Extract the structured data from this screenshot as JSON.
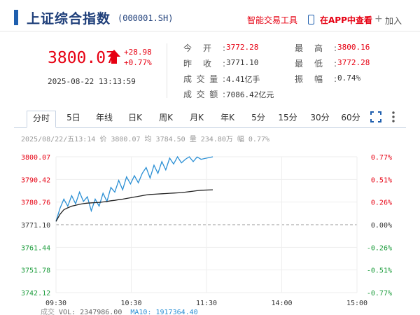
{
  "header": {
    "title": "上证综合指数",
    "code": "(000001.SH)",
    "smart_tools": "智能交易工具",
    "app_view": "在APP中查看",
    "add_label": "加入"
  },
  "quote": {
    "price": "3800.07",
    "change": "+28.98",
    "change_pct": "+0.77%",
    "datetime": "2025-08-22 13:13:59",
    "fields": [
      {
        "label": "今开:",
        "value": "3772.28",
        "color": "red"
      },
      {
        "label": "昨收:",
        "value": "3771.10",
        "color": "normal"
      },
      {
        "label": "成交量:",
        "value": "4.41亿手",
        "color": "normal"
      },
      {
        "label": "成交额:",
        "value": "7086.42亿元",
        "color": "normal"
      },
      {
        "label": "最高:",
        "value": "3800.16",
        "color": "red"
      },
      {
        "label": "最低:",
        "value": "3772.28",
        "color": "red"
      },
      {
        "label": "振幅:",
        "value": "0.74%",
        "color": "normal"
      }
    ]
  },
  "tabs": [
    "分时",
    "5日",
    "年线",
    "日K",
    "周K",
    "月K",
    "年K",
    "5分",
    "15分",
    "30分",
    "60分"
  ],
  "active_tab": "分时",
  "infoline": "2025/08/22/五13:14 价 3800.07 均 3784.50 量 234.80万 幅 0.77%",
  "bottom": {
    "prefix": "成交",
    "vol": "VOL: 2347986.00",
    "ma10": "MA10: 1917364.40"
  },
  "colors": {
    "up": "#e60012",
    "down": "#1a9b3a",
    "price_line": "#2a8fd4",
    "avg_line": "#222222",
    "brand": "#1f5fae"
  },
  "chart_data": {
    "type": "line",
    "y_left_ticks": [
      "3800.07",
      "3790.42",
      "3780.76",
      "3771.10",
      "3761.44",
      "3751.78",
      "3742.12"
    ],
    "y_right_ticks": [
      "0.77%",
      "0.51%",
      "0.26%",
      "0.00%",
      "-0.26%",
      "-0.51%",
      "-0.77%"
    ],
    "x_ticks": [
      "09:30",
      "10:30",
      "11:30",
      "14:00",
      "15:00"
    ],
    "ylim": [
      3742.12,
      3800.07
    ],
    "x_time_minutes": [
      0,
      5,
      10,
      15,
      20,
      25,
      30,
      35,
      40,
      45,
      50,
      55,
      60,
      65,
      70,
      75,
      80,
      85,
      90,
      95,
      100,
      105,
      110,
      115,
      120,
      125,
      130,
      135,
      140,
      145,
      150,
      155,
      160,
      165,
      170,
      175,
      180,
      185,
      200
    ],
    "series": [
      {
        "values": [
          3772.5,
          3778.0,
          3782.0,
          3779.0,
          3783.5,
          3780.0,
          3785.0,
          3781.0,
          3783.0,
          3777.0,
          3782.0,
          3779.0,
          3784.5,
          3781.0,
          3787.0,
          3785.0,
          3790.0,
          3786.0,
          3791.5,
          3788.5,
          3792.0,
          3789.0,
          3793.0,
          3795.5,
          3791.0,
          3796.5,
          3793.0,
          3798.0,
          3794.5,
          3799.5,
          3797.0,
          3800.07,
          3797.5,
          3799.0,
          3800.07,
          3798.0,
          3800.0,
          3799.0,
          3800.07
        ]
      },
      {
        "values": [
          3772.5,
          3775.5,
          3777.5,
          3778.3,
          3779.0,
          3779.4,
          3779.8,
          3780.1,
          3780.3,
          3780.4,
          3780.5,
          3780.6,
          3780.8,
          3781.0,
          3781.3,
          3781.5,
          3781.8,
          3782.0,
          3782.3,
          3782.6,
          3782.9,
          3783.2,
          3783.5,
          3783.8,
          3784.0,
          3784.1,
          3784.2,
          3784.3,
          3784.4,
          3784.5,
          3784.6,
          3784.7,
          3784.8,
          3785.0,
          3785.2,
          3785.4,
          3785.6,
          3785.8,
          3786.0
        ]
      }
    ]
  }
}
